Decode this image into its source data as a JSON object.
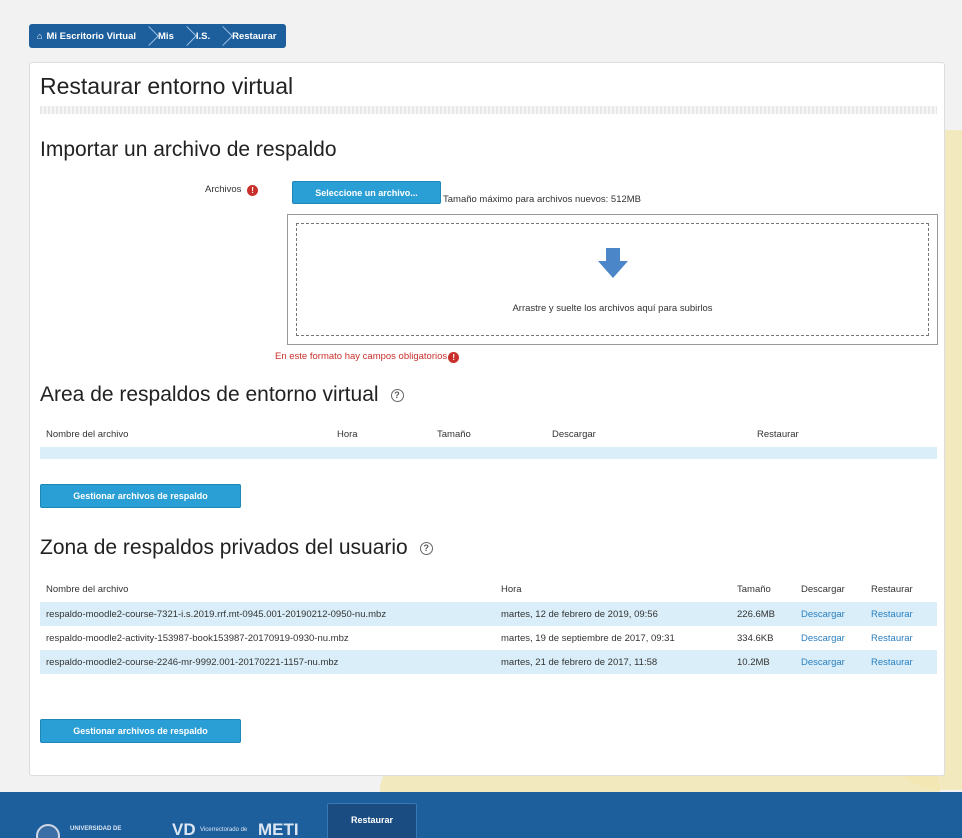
{
  "breadcrumb": {
    "items": [
      "Mi Escritorio Virtual",
      "Mis",
      "I.S.",
      "Restaurar"
    ]
  },
  "page": {
    "title": "Restaurar entorno virtual"
  },
  "import_section": {
    "heading": "Importar un archivo de respaldo",
    "files_label": "Archivos",
    "choose_button": "Seleccione un archivo...",
    "max_size_text": "Tamaño máximo para archivos nuevos: 512MB",
    "drop_text": "Arrastre y suelte los archivos aquí para subirlos",
    "required_note": "En este formato hay campos obligatorios"
  },
  "course_area": {
    "heading": "Area de respaldos de entorno virtual",
    "columns": [
      "Nombre del archivo",
      "Hora",
      "Tamaño",
      "Descargar",
      "Restaurar"
    ],
    "manage_button": "Gestionar archivos de respaldo"
  },
  "user_area": {
    "heading": "Zona de respaldos privados del usuario",
    "columns": [
      "Nombre del archivo",
      "Hora",
      "Tamaño",
      "Descargar",
      "Restaurar"
    ],
    "rows": [
      {
        "name": "respaldo-moodle2-course-7321-i.s.2019.rrf.mt-0945.001-20190212-0950-nu.mbz",
        "time": "martes, 12 de febrero de 2019, 09:56",
        "size": "226.6MB",
        "download": "Descargar",
        "restore": "Restaurar"
      },
      {
        "name": "respaldo-moodle2-activity-153987-book153987-20170919-0930-nu.mbz",
        "time": "martes, 19 de septiembre de 2017, 09:31",
        "size": "334.6KB",
        "download": "Descargar",
        "restore": "Restaurar"
      },
      {
        "name": "respaldo-moodle2-course-2246-mr-9992.001-20170221-1157-nu.mbz",
        "time": "martes, 21 de febrero de 2017, 11:58",
        "size": "10.2MB",
        "download": "Descargar",
        "restore": "Restaurar"
      }
    ],
    "manage_button": "Gestionar archivos de respaldo"
  },
  "footer": {
    "tab_label": "Restaurar",
    "brand1": "UNIVERSIDAD DE",
    "brand2": "VD",
    "brand3": "Vicerrectorado de",
    "brand4": "METI"
  },
  "colors": {
    "brand_blue": "#1d5e9c",
    "button_blue": "#2a9fd6",
    "row_highlight": "#d9eef8",
    "required_red": "#c9302c",
    "link": "#2a7fc0"
  }
}
